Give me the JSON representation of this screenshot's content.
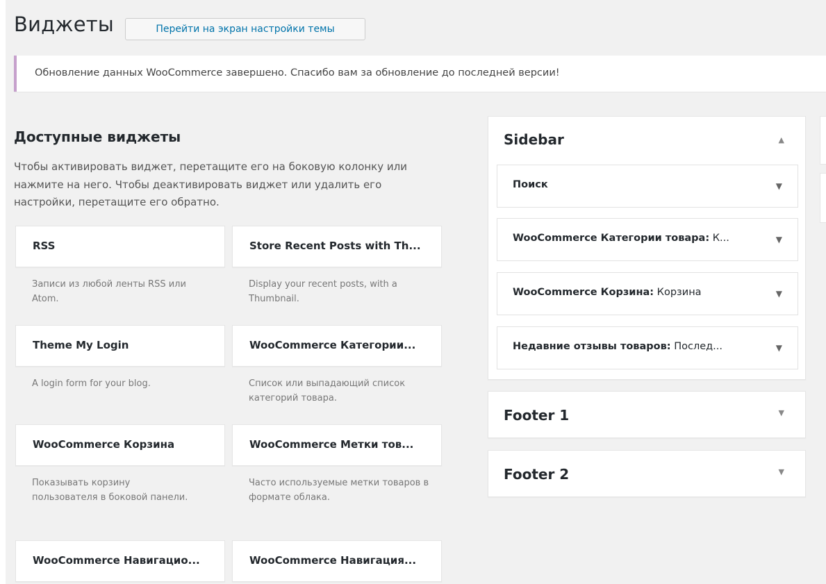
{
  "header": {
    "title": "Виджеты",
    "theme_button": "Перейти на экран настройки темы"
  },
  "notice": {
    "text": "Обновление данных WooCommerce завершено. Спасибо вам за обновление до последней версии!",
    "border_color": "#c6a0cc"
  },
  "available": {
    "title": "Доступные виджеты",
    "description": "Чтобы активировать виджет, перетащите его на боковую колонку или нажмите на него. Чтобы деактивировать виджет или удалить его настройки, перетащите его обратно.",
    "widgets": [
      {
        "label": "RSS",
        "description": "Записи из любой ленты RSS или Atom."
      },
      {
        "label": "Store Recent Posts with Th...",
        "description": "Display your recent posts, with a Thumbnail."
      },
      {
        "label": "Theme My Login",
        "description": "A login form for your blog."
      },
      {
        "label": "WooCommerce Категории...",
        "description": "Список или выпадающий список категорий товара."
      },
      {
        "label": "WooCommerce Корзина",
        "description": "Показывать корзину пользователя в боковой панели."
      },
      {
        "label": "WooCommerce Метки тов...",
        "description": "Часто используемые метки товаров в формате облака."
      },
      {
        "label": "WooCommerce Навигацио...",
        "description": ""
      },
      {
        "label": "WooCommerce Навигация...",
        "description": ""
      }
    ]
  },
  "areas": {
    "sidebar": {
      "title": "Sidebar",
      "icon": "arrow-up-icon",
      "widgets": [
        {
          "name": "Поиск",
          "instance": ""
        },
        {
          "name": "WooCommerce Категории товара:",
          "instance": " К..."
        },
        {
          "name": "WooCommerce Корзина:",
          "instance": " Корзина"
        },
        {
          "name": "Недавние отзывы товаров:",
          "instance": " Послед..."
        }
      ]
    },
    "footer1": {
      "title": "Footer 1",
      "icon": "arrow-down-icon"
    },
    "footer2": {
      "title": "Footer 2",
      "icon": "arrow-down-icon"
    }
  }
}
